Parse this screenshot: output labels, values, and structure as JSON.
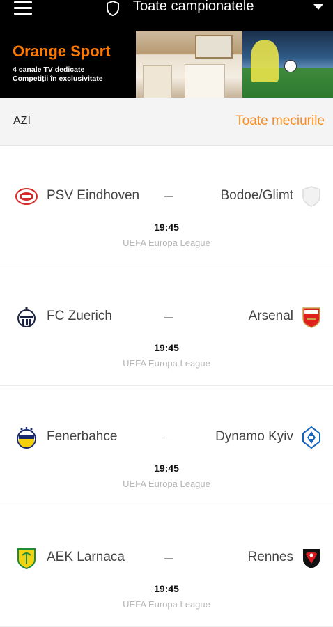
{
  "topbar": {
    "title": "Toate campionatele",
    "menu_icon": "hamburger-menu-icon",
    "shield_icon": "shield-icon",
    "dropdown_icon": "caret-down-icon"
  },
  "banner": {
    "brand": "Orange Sport",
    "line1": "4 canale TV dedicate",
    "line2": "Competiții în exclusivitate",
    "brand_color": "#ff7900"
  },
  "section": {
    "title": "AZI",
    "all_matches": "Toate meciurile",
    "accent": "#ff8c1a"
  },
  "matches": [
    {
      "home": "PSV Eindhoven",
      "away": "Bodoe/Glimt",
      "time": "19:45",
      "league": "UEFA Europa League",
      "home_icon": "psv-crest-icon",
      "away_icon": "placeholder-shield-icon"
    },
    {
      "home": "FC Zuerich",
      "away": "Arsenal",
      "time": "19:45",
      "league": "UEFA Europa League",
      "home_icon": "fc-zuerich-crest-icon",
      "away_icon": "arsenal-crest-icon"
    },
    {
      "home": "Fenerbahce",
      "away": "Dynamo Kyiv",
      "time": "19:45",
      "league": "UEFA Europa League",
      "home_icon": "fenerbahce-crest-icon",
      "away_icon": "dynamo-kyiv-crest-icon"
    },
    {
      "home": "AEK Larnaca",
      "away": "Rennes",
      "time": "19:45",
      "league": "UEFA Europa League",
      "home_icon": "aek-larnaca-crest-icon",
      "away_icon": "rennes-crest-icon"
    }
  ]
}
